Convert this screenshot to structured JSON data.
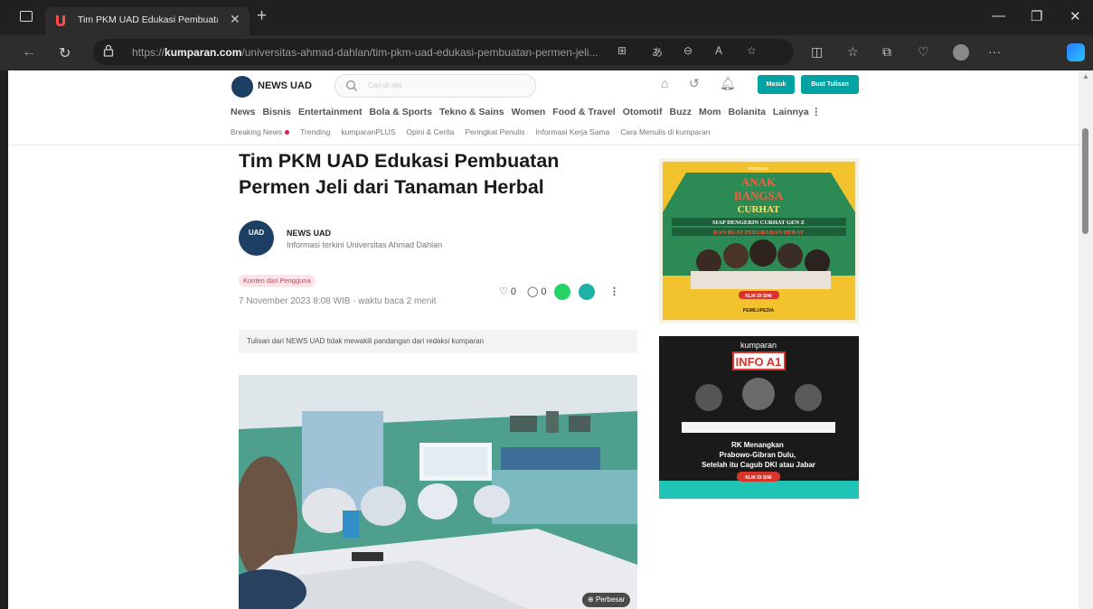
{
  "browser": {
    "tab_title": "Tim PKM UAD Edukasi Pembuata",
    "url_prefix": "https://",
    "url_domain": "kumparan.com",
    "url_path": "/universitas-ahmad-dahlan/tim-pkm-uad-edukasi-pembuatan-permen-jeli...",
    "colors": {
      "frame": "#202020",
      "toolbar": "#2d2d2d",
      "tab_accent": "#ff4b4b"
    }
  },
  "site": {
    "brand": "NEWS UAD",
    "search_placeholder": "Cari di sini",
    "login_label": "Masuk",
    "write_label": "Buat Tulisan",
    "accent": "#00a3a3",
    "nav": [
      "News",
      "Bisnis",
      "Entertainment",
      "Bola & Sports",
      "Tekno & Sains",
      "Women",
      "Food & Travel",
      "Otomotif",
      "Buzz",
      "Mom",
      "Bolanita",
      "Lainnya ⋮"
    ],
    "subnav": [
      "Breaking News",
      "Trending",
      "kumparanPLUS",
      "Opini & Cerita",
      "Peringkat Penulis",
      "Informasi Kerja Sama",
      "Cara Menulis di kumparan"
    ]
  },
  "article": {
    "title": "Tim PKM UAD Edukasi Pembuatan Permen Jeli dari Tanaman Herbal",
    "avatar_text": "UAD",
    "author_name": "NEWS UAD",
    "author_desc": "Informasi terkini Universitas Ahmad Dahlan",
    "badge": "Konten dari Pengguna",
    "date": "7 November 2023 8:08 WIB · waktu baca 2 menit",
    "likes": "0",
    "comments": "0",
    "notice": "Tulisan dari NEWS UAD tidak mewakili pandangan dari redaksi kumparan",
    "image_button": "Perbesar"
  },
  "ads": {
    "ad1": {
      "brand": "kumparan",
      "headline_1": "ANAK",
      "headline_2": "BANGSA",
      "headline_3": "CURHAT",
      "tagline_1": "SIAP DENGERIN CURHAT GEN Z",
      "tagline_2": "DAN BUAT PERUBAHAN HEBAT",
      "cta": "KLIK DI SINI",
      "footer": "PEMILUPEDIA"
    },
    "ad2": {
      "brand": "kumparan",
      "title": "INFO A1",
      "headline": "RK Menangkan Prabowo-Gibran Dulu, Setelah itu Cagub DKI atau Jabar",
      "cta": "KLIK DI SINI"
    }
  }
}
